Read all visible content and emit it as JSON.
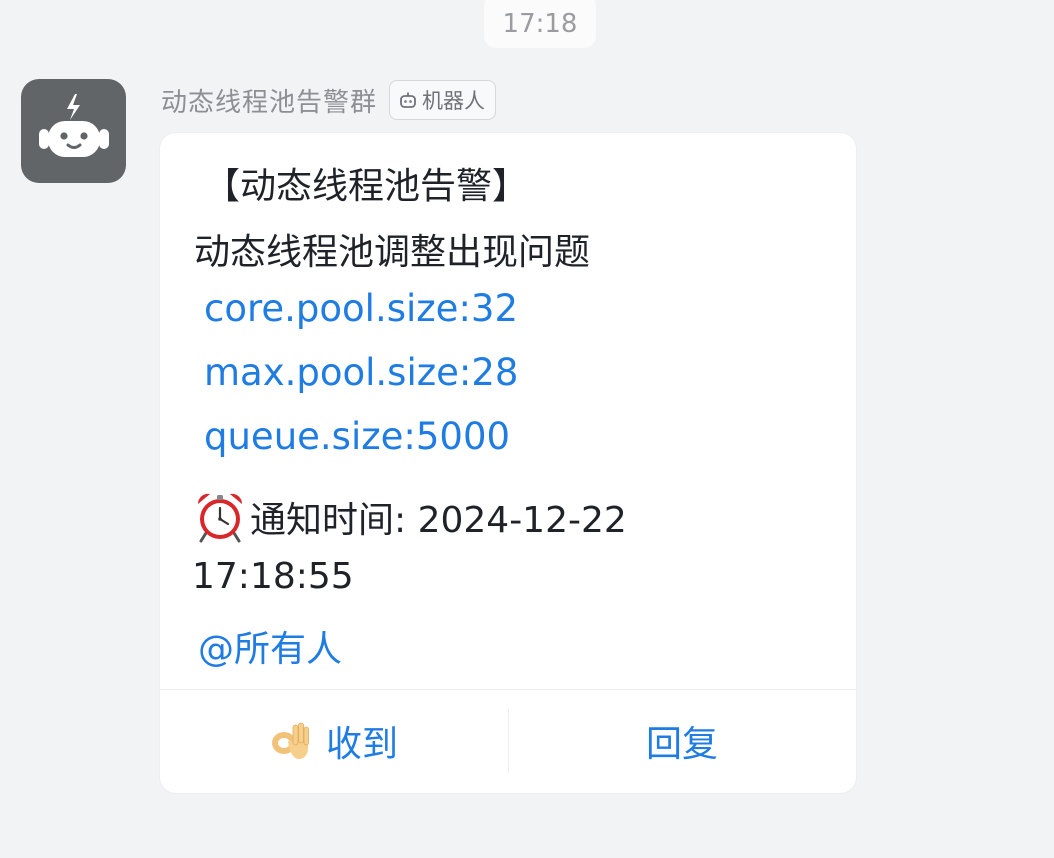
{
  "header": {
    "time": "17:18"
  },
  "message": {
    "sender_name": "动态线程池告警群",
    "sender_tag": "机器人",
    "avatar_icon": "robot-icon",
    "title": "【动态线程池告警】",
    "subtitle": "动态线程池调整出现问题",
    "details": [
      "core.pool.size:32",
      "max.pool.size:28",
      "queue.size:5000"
    ],
    "notify_icon": "alarm-clock-icon",
    "notify_label": "通知时间: 2024-12-22",
    "notify_time": "17:18:55",
    "mention": "@所有人"
  },
  "actions": {
    "received_icon": "ok-hand-icon",
    "received_label": "收到",
    "reply_label": "回复"
  },
  "colors": {
    "background": "#f2f3f5",
    "link": "#1f7ce3",
    "avatar": "#626568"
  }
}
